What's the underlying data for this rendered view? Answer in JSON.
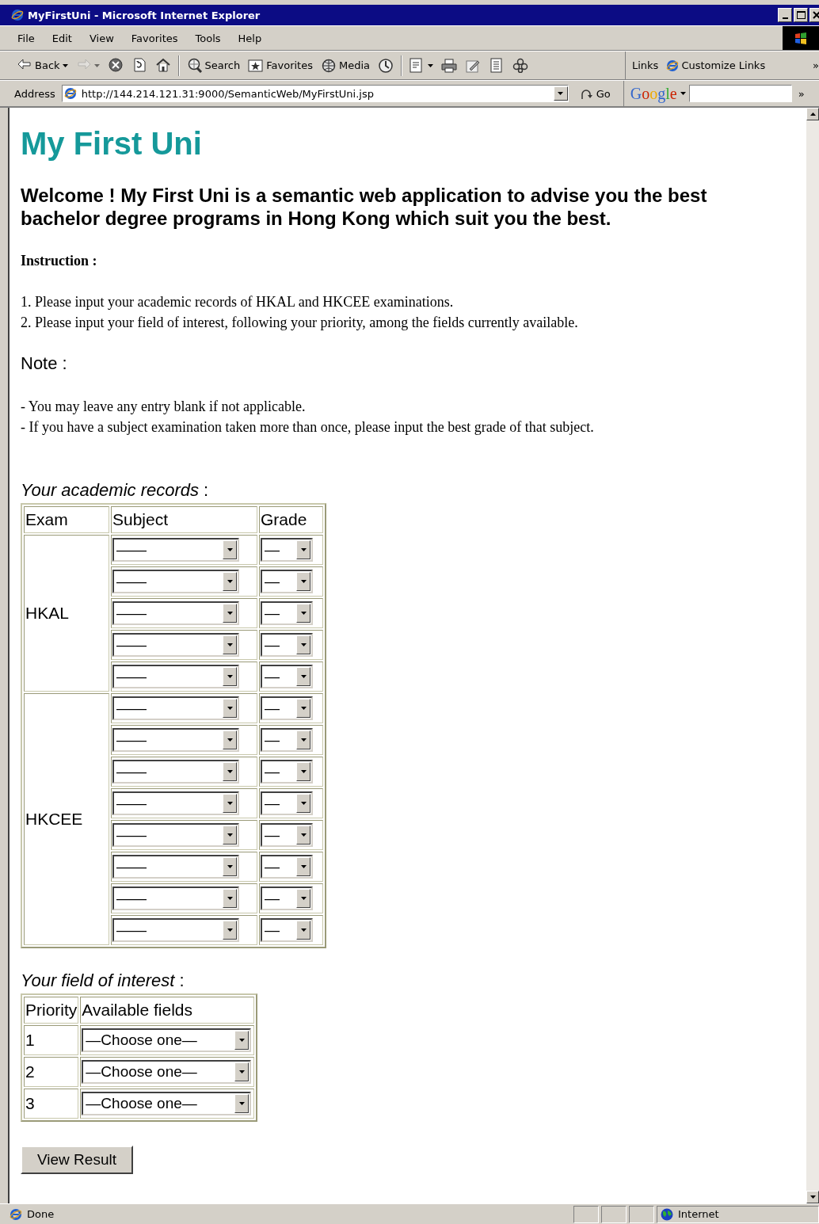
{
  "window": {
    "title": "MyFirstUni - Microsoft Internet Explorer"
  },
  "menu": [
    "File",
    "Edit",
    "View",
    "Favorites",
    "Tools",
    "Help"
  ],
  "toolbar": {
    "groups": [
      [
        {
          "label": "Back",
          "dropdown": true,
          "disabled": false
        },
        {
          "dropdown": true,
          "disabled": true
        },
        {
          "dropdown": false,
          "disabled": false
        },
        {
          "dropdown": false,
          "disabled": false
        },
        {
          "dropdown": false,
          "disabled": false
        }
      ],
      [
        {
          "label": "Search",
          "dropdown": false,
          "disabled": false
        },
        {
          "label": "Favorites",
          "dropdown": false,
          "disabled": false
        },
        {
          "label": "Media",
          "dropdown": false,
          "disabled": false
        },
        {
          "dropdown": false,
          "disabled": false
        }
      ],
      [
        {
          "dropdown": true,
          "disabled": false
        },
        {
          "dropdown": false,
          "disabled": false
        },
        {
          "dropdown": false,
          "disabled": false
        },
        {
          "dropdown": false,
          "disabled": false
        },
        {
          "dropdown": false,
          "disabled": false
        }
      ]
    ],
    "links_label": "Links",
    "links": [
      "Customize Links"
    ],
    "chevron": "»"
  },
  "address": {
    "label": "Address",
    "url": "http://144.214.121.31:9000/SemanticWeb/MyFirstUni.jsp",
    "go": "Go",
    "search_logo": "Google",
    "chevron": "»"
  },
  "page": {
    "heading": "My First Uni",
    "welcome": "Welcome ! My First Uni is a semantic web application to advise you the best bachelor degree programs in Hong Kong which suit you the best.",
    "instruction_label": "Instruction :",
    "instructions": [
      "1. Please input your academic records of HKAL and HKCEE examinations.",
      "2. Please input your field of interest, following your priority, among the fields currently available."
    ],
    "note_label": "Note :",
    "notes": [
      "- You may leave any entry blank if not applicable.",
      "- If you have a subject examination taken more than once, please input the best grade of that subject."
    ],
    "records": {
      "caption": "*Your academic records* :",
      "columns": [
        "Exam",
        "Subject",
        "Grade"
      ],
      "groups": [
        {
          "exam": "HKAL",
          "rows": [
            {
              "subject": "——",
              "grade": "—"
            },
            {
              "subject": "——",
              "grade": "—"
            },
            {
              "subject": "——",
              "grade": "—"
            },
            {
              "subject": "——",
              "grade": "—"
            },
            {
              "subject": "——",
              "grade": "—"
            }
          ]
        },
        {
          "exam": "HKCEE",
          "rows": [
            {
              "subject": "——",
              "grade": "—"
            },
            {
              "subject": "——",
              "grade": "—"
            },
            {
              "subject": "——",
              "grade": "—"
            },
            {
              "subject": "——",
              "grade": "—"
            },
            {
              "subject": "——",
              "grade": "—"
            },
            {
              "subject": "——",
              "grade": "—"
            },
            {
              "subject": "——",
              "grade": "—"
            },
            {
              "subject": "——",
              "grade": "—"
            }
          ]
        }
      ]
    },
    "interest": {
      "caption": "*Your field of interest* :",
      "columns": [
        "Priority",
        "Available fields"
      ],
      "rows": [
        {
          "priority": "1",
          "field": "—Choose one—"
        },
        {
          "priority": "2",
          "field": "—Choose one—"
        },
        {
          "priority": "3",
          "field": "—Choose one—"
        }
      ]
    },
    "submit": "View Result"
  },
  "status": {
    "text": "Done",
    "zone": "Internet"
  }
}
